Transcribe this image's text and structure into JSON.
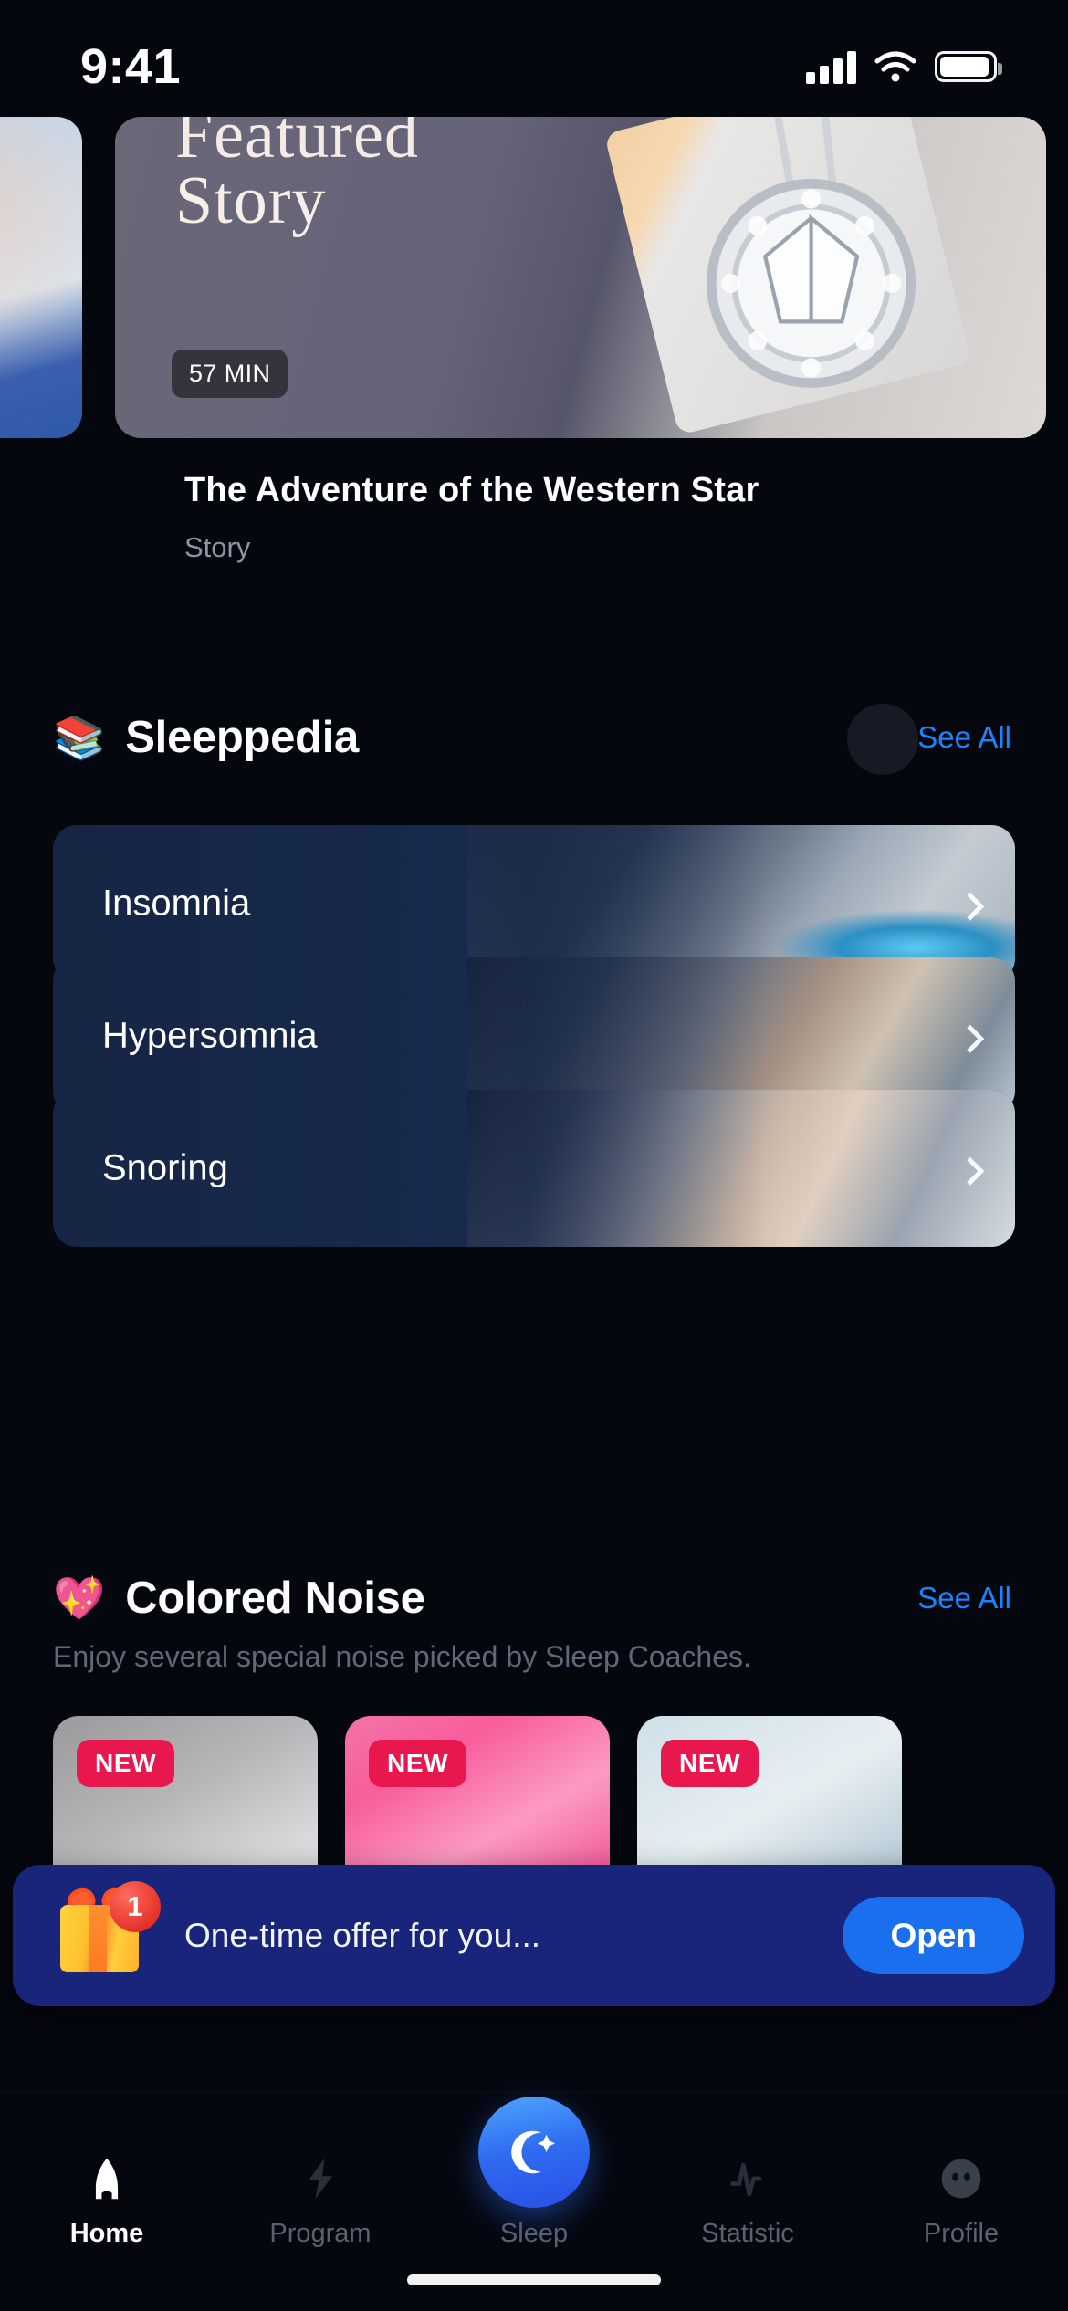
{
  "status_bar": {
    "time": "9:41",
    "signal_icon": "cellular-signal-icon",
    "wifi_icon": "wifi-icon",
    "battery_icon": "battery-icon"
  },
  "featured": {
    "kicker": "Featured",
    "word": "Story",
    "duration_badge": "57 MIN",
    "title": "The Adventure of the Western Star",
    "subtitle": "Story"
  },
  "sleeppedia": {
    "emoji": "📚",
    "title": "Sleeppedia",
    "see_all": "See All",
    "items": [
      {
        "label": "Insomnia"
      },
      {
        "label": "Hypersomnia"
      },
      {
        "label": "Snoring"
      }
    ]
  },
  "colored_noise": {
    "emoji": "💖",
    "title": "Colored Noise",
    "see_all": "See All",
    "description": "Enjoy several special noise picked by Sleep Coaches.",
    "cards": [
      {
        "badge": "NEW"
      },
      {
        "badge": "NEW"
      },
      {
        "badge": "NEW"
      }
    ]
  },
  "offer_banner": {
    "gift_icon": "gift-icon",
    "count_badge": "1",
    "text": "One-time offer for you...",
    "button_label": "Open"
  },
  "tab_bar": {
    "tabs": [
      {
        "label": "Home",
        "icon": "home-icon",
        "active": true
      },
      {
        "label": "Program",
        "icon": "bolt-icon",
        "active": false
      },
      {
        "label": "Sleep",
        "icon": "moon-icon",
        "active": false
      },
      {
        "label": "Statistic",
        "icon": "pulse-icon",
        "active": false
      },
      {
        "label": "Profile",
        "icon": "face-icon",
        "active": false
      }
    ]
  },
  "colors": {
    "background": "#05070f",
    "accent_blue": "#1a84ff",
    "button_blue": "#1a6fee",
    "badge_red": "#e8174e",
    "banner_navy": "#18257a",
    "card_navy": "#162544"
  }
}
